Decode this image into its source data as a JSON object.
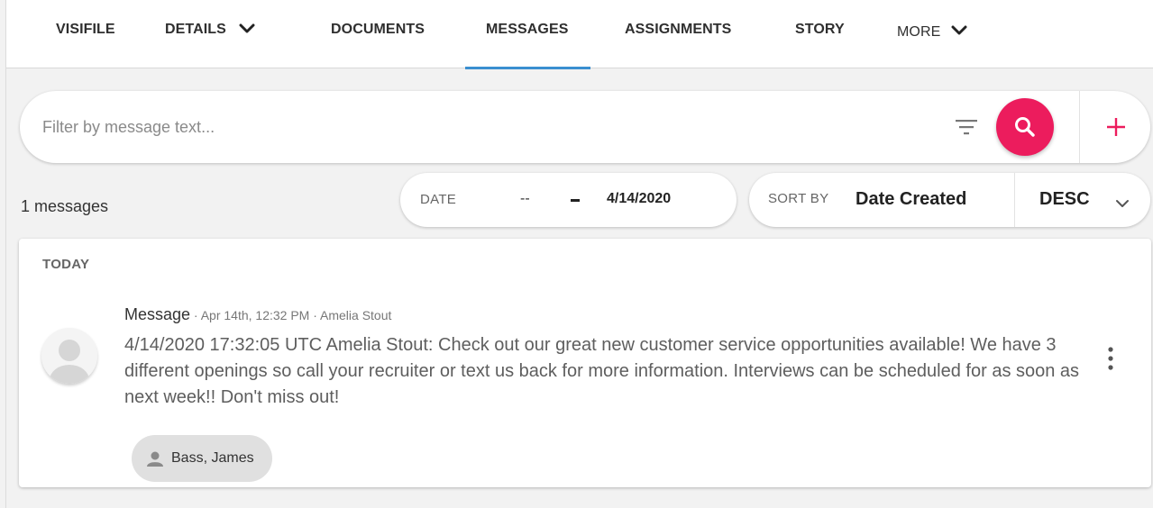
{
  "tabs": [
    {
      "label": "VISIFILE",
      "has_dropdown": false,
      "active": false
    },
    {
      "label": "DETAILS",
      "has_dropdown": true,
      "active": false
    },
    {
      "label": "DOCUMENTS",
      "has_dropdown": false,
      "active": false
    },
    {
      "label": "MESSAGES",
      "has_dropdown": false,
      "active": true
    },
    {
      "label": "ASSIGNMENTS",
      "has_dropdown": false,
      "active": false
    },
    {
      "label": "STORY",
      "has_dropdown": false,
      "active": false
    },
    {
      "label": "MORE",
      "has_dropdown": true,
      "active": false
    }
  ],
  "search": {
    "placeholder": "Filter by message text...",
    "value": "",
    "filter_icon": "filter-lines-icon",
    "search_icon": "magnifier-icon",
    "add_icon": "plus-icon"
  },
  "toolbar": {
    "count_text": "1 messages",
    "date_label": "DATE",
    "date_from": "--",
    "date_to": "4/14/2020",
    "sort_label": "SORT BY",
    "sort_field": "Date Created",
    "sort_direction": "DESC"
  },
  "messages": {
    "group_label": "TODAY",
    "items": [
      {
        "type": "Message",
        "meta": " · Apr 14th, 12:32 PM · Amelia Stout",
        "body": "4/14/2020 17:32:05 UTC Amelia Stout: Check out our great new customer service opportunities available! We have 3 different openings so call your recruiter or text us back for more information. Interviews can be scheduled for as soon as next week!! Don't miss out!",
        "recipient": "Bass, James"
      }
    ]
  },
  "colors": {
    "accent": "#ec1c5d",
    "active_tab": "#3a8fd0",
    "background": "#f2f2f2"
  }
}
